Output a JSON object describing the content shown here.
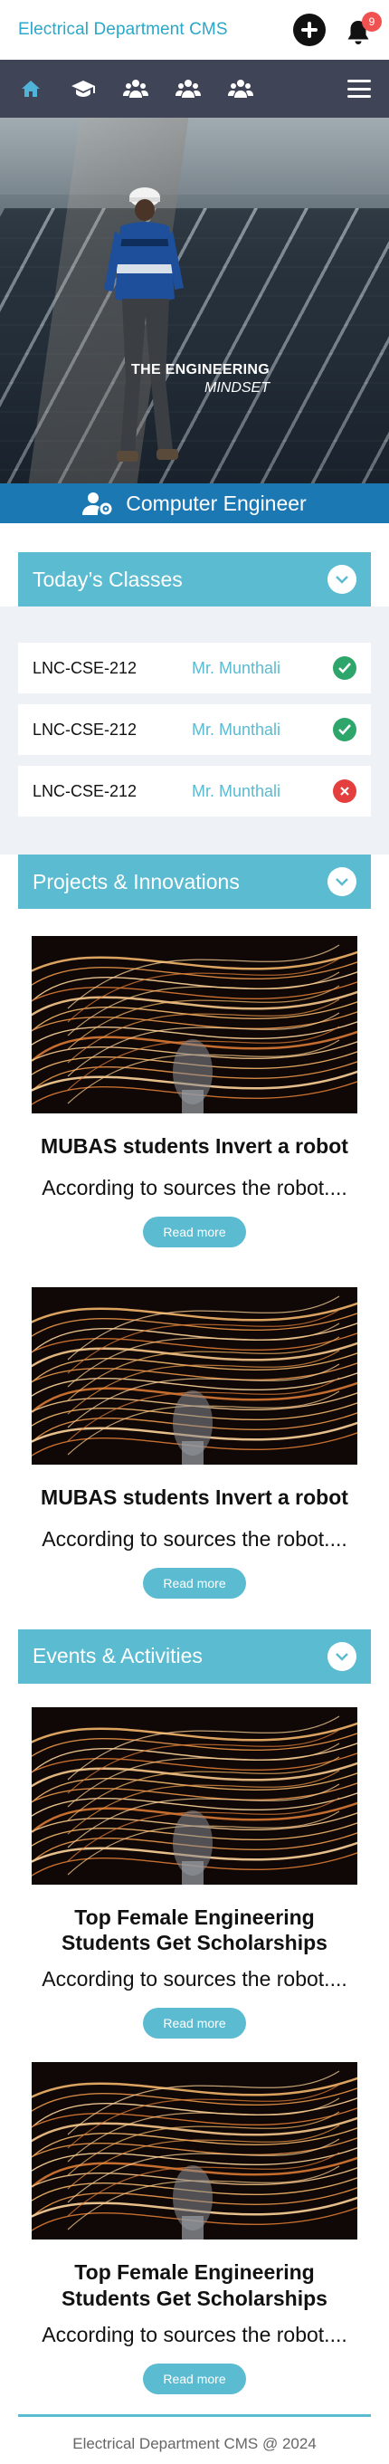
{
  "header": {
    "title": "Electrical Department CMS",
    "notification_count": "9",
    "accent_color": "#2aa7c9"
  },
  "nav": {
    "icons": [
      "home-icon",
      "graduation-cap-icon",
      "group-icon",
      "group-icon",
      "group-icon",
      "menu-icon"
    ]
  },
  "hero": {
    "line1": "THE ENGINEERING",
    "line2": "MINDSET"
  },
  "role": {
    "label": "Computer Engineer"
  },
  "classes": {
    "title": "Today’s Classes",
    "items": [
      {
        "code": "LNC-CSE-212",
        "teacher": "Mr. Munthali",
        "status": "present"
      },
      {
        "code": "LNC-CSE-212",
        "teacher": "Mr. Munthali",
        "status": "present"
      },
      {
        "code": "LNC-CSE-212",
        "teacher": "Mr. Munthali",
        "status": "absent"
      }
    ]
  },
  "projects": {
    "title": "Projects & Innovations",
    "items": [
      {
        "title": "MUBAS students Invert a robot",
        "desc": "According to sources the robot....",
        "button": "Read more"
      },
      {
        "title": "MUBAS students Invert a robot",
        "desc": "According to sources the robot....",
        "button": "Read more"
      }
    ]
  },
  "events": {
    "title": "Events & Activities",
    "items": [
      {
        "title": "Top Female Engineering Students Get Scholarships",
        "desc": "According to sources the robot....",
        "button": "Read more"
      },
      {
        "title": "Top Female Engineering Students Get Scholarships",
        "desc": "According to sources the robot....",
        "button": "Read more"
      }
    ]
  },
  "footer": {
    "text": "Electrical Department CMS @ 2024"
  },
  "colors": {
    "nav_bg": "#3f4457",
    "role_bg": "#1b78b3",
    "section_bg": "#5bbbd1",
    "ok": "#2ea66b",
    "bad": "#e53e3e"
  }
}
